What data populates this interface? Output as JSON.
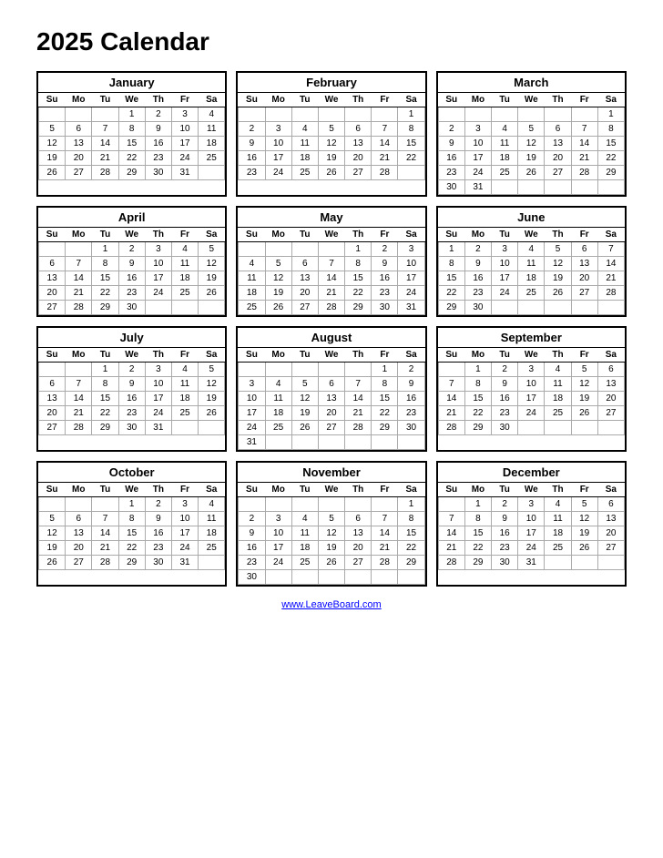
{
  "page": {
    "title": "2025 Calendar",
    "footer_link": "www.LeaveBoard.com"
  },
  "months": [
    {
      "name": "January",
      "days_header": [
        "Su",
        "Mo",
        "Tu",
        "We",
        "Th",
        "Fr",
        "Sa"
      ],
      "weeks": [
        [
          "",
          "",
          "",
          "1",
          "2",
          "3",
          "4"
        ],
        [
          "5",
          "6",
          "7",
          "8",
          "9",
          "10",
          "11"
        ],
        [
          "12",
          "13",
          "14",
          "15",
          "16",
          "17",
          "18"
        ],
        [
          "19",
          "20",
          "21",
          "22",
          "23",
          "24",
          "25"
        ],
        [
          "26",
          "27",
          "28",
          "29",
          "30",
          "31",
          ""
        ]
      ]
    },
    {
      "name": "February",
      "days_header": [
        "Su",
        "Mo",
        "Tu",
        "We",
        "Th",
        "Fr",
        "Sa"
      ],
      "weeks": [
        [
          "",
          "",
          "",
          "",
          "",
          "",
          "1"
        ],
        [
          "2",
          "3",
          "4",
          "5",
          "6",
          "7",
          "8"
        ],
        [
          "9",
          "10",
          "11",
          "12",
          "13",
          "14",
          "15"
        ],
        [
          "16",
          "17",
          "18",
          "19",
          "20",
          "21",
          "22"
        ],
        [
          "23",
          "24",
          "25",
          "26",
          "27",
          "28",
          ""
        ]
      ]
    },
    {
      "name": "March",
      "days_header": [
        "Su",
        "Mo",
        "Tu",
        "We",
        "Th",
        "Fr",
        "Sa"
      ],
      "weeks": [
        [
          "",
          "",
          "",
          "",
          "",
          "",
          "1"
        ],
        [
          "2",
          "3",
          "4",
          "5",
          "6",
          "7",
          "8"
        ],
        [
          "9",
          "10",
          "11",
          "12",
          "13",
          "14",
          "15"
        ],
        [
          "16",
          "17",
          "18",
          "19",
          "20",
          "21",
          "22"
        ],
        [
          "23",
          "24",
          "25",
          "26",
          "27",
          "28",
          "29"
        ],
        [
          "30",
          "31",
          "",
          "",
          "",
          "",
          ""
        ]
      ]
    },
    {
      "name": "April",
      "days_header": [
        "Su",
        "Mo",
        "Tu",
        "We",
        "Th",
        "Fr",
        "Sa"
      ],
      "weeks": [
        [
          "",
          "",
          "1",
          "2",
          "3",
          "4",
          "5"
        ],
        [
          "6",
          "7",
          "8",
          "9",
          "10",
          "11",
          "12"
        ],
        [
          "13",
          "14",
          "15",
          "16",
          "17",
          "18",
          "19"
        ],
        [
          "20",
          "21",
          "22",
          "23",
          "24",
          "25",
          "26"
        ],
        [
          "27",
          "28",
          "29",
          "30",
          "",
          "",
          ""
        ]
      ]
    },
    {
      "name": "May",
      "days_header": [
        "Su",
        "Mo",
        "Tu",
        "We",
        "Th",
        "Fr",
        "Sa"
      ],
      "weeks": [
        [
          "",
          "",
          "",
          "",
          "1",
          "2",
          "3"
        ],
        [
          "4",
          "5",
          "6",
          "7",
          "8",
          "9",
          "10"
        ],
        [
          "11",
          "12",
          "13",
          "14",
          "15",
          "16",
          "17"
        ],
        [
          "18",
          "19",
          "20",
          "21",
          "22",
          "23",
          "24"
        ],
        [
          "25",
          "26",
          "27",
          "28",
          "29",
          "30",
          "31"
        ]
      ]
    },
    {
      "name": "June",
      "days_header": [
        "Su",
        "Mo",
        "Tu",
        "We",
        "Th",
        "Fr",
        "Sa"
      ],
      "weeks": [
        [
          "1",
          "2",
          "3",
          "4",
          "5",
          "6",
          "7"
        ],
        [
          "8",
          "9",
          "10",
          "11",
          "12",
          "13",
          "14"
        ],
        [
          "15",
          "16",
          "17",
          "18",
          "19",
          "20",
          "21"
        ],
        [
          "22",
          "23",
          "24",
          "25",
          "26",
          "27",
          "28"
        ],
        [
          "29",
          "30",
          "",
          "",
          "",
          "",
          ""
        ]
      ]
    },
    {
      "name": "July",
      "days_header": [
        "Su",
        "Mo",
        "Tu",
        "We",
        "Th",
        "Fr",
        "Sa"
      ],
      "weeks": [
        [
          "",
          "",
          "1",
          "2",
          "3",
          "4",
          "5"
        ],
        [
          "6",
          "7",
          "8",
          "9",
          "10",
          "11",
          "12"
        ],
        [
          "13",
          "14",
          "15",
          "16",
          "17",
          "18",
          "19"
        ],
        [
          "20",
          "21",
          "22",
          "23",
          "24",
          "25",
          "26"
        ],
        [
          "27",
          "28",
          "29",
          "30",
          "31",
          "",
          ""
        ]
      ]
    },
    {
      "name": "August",
      "days_header": [
        "Su",
        "Mo",
        "Tu",
        "We",
        "Th",
        "Fr",
        "Sa"
      ],
      "weeks": [
        [
          "",
          "",
          "",
          "",
          "",
          "1",
          "2"
        ],
        [
          "3",
          "4",
          "5",
          "6",
          "7",
          "8",
          "9"
        ],
        [
          "10",
          "11",
          "12",
          "13",
          "14",
          "15",
          "16"
        ],
        [
          "17",
          "18",
          "19",
          "20",
          "21",
          "22",
          "23"
        ],
        [
          "24",
          "25",
          "26",
          "27",
          "28",
          "29",
          "30"
        ],
        [
          "31",
          "",
          "",
          "",
          "",
          "",
          ""
        ]
      ]
    },
    {
      "name": "September",
      "days_header": [
        "Su",
        "Mo",
        "Tu",
        "We",
        "Th",
        "Fr",
        "Sa"
      ],
      "weeks": [
        [
          "",
          "1",
          "2",
          "3",
          "4",
          "5",
          "6"
        ],
        [
          "7",
          "8",
          "9",
          "10",
          "11",
          "12",
          "13"
        ],
        [
          "14",
          "15",
          "16",
          "17",
          "18",
          "19",
          "20"
        ],
        [
          "21",
          "22",
          "23",
          "24",
          "25",
          "26",
          "27"
        ],
        [
          "28",
          "29",
          "30",
          "",
          "",
          "",
          ""
        ]
      ]
    },
    {
      "name": "October",
      "days_header": [
        "Su",
        "Mo",
        "Tu",
        "We",
        "Th",
        "Fr",
        "Sa"
      ],
      "weeks": [
        [
          "",
          "",
          "",
          "1",
          "2",
          "3",
          "4"
        ],
        [
          "5",
          "6",
          "7",
          "8",
          "9",
          "10",
          "11"
        ],
        [
          "12",
          "13",
          "14",
          "15",
          "16",
          "17",
          "18"
        ],
        [
          "19",
          "20",
          "21",
          "22",
          "23",
          "24",
          "25"
        ],
        [
          "26",
          "27",
          "28",
          "29",
          "30",
          "31",
          ""
        ]
      ]
    },
    {
      "name": "November",
      "days_header": [
        "Su",
        "Mo",
        "Tu",
        "We",
        "Th",
        "Fr",
        "Sa"
      ],
      "weeks": [
        [
          "",
          "",
          "",
          "",
          "",
          "",
          "1"
        ],
        [
          "2",
          "3",
          "4",
          "5",
          "6",
          "7",
          "8"
        ],
        [
          "9",
          "10",
          "11",
          "12",
          "13",
          "14",
          "15"
        ],
        [
          "16",
          "17",
          "18",
          "19",
          "20",
          "21",
          "22"
        ],
        [
          "23",
          "24",
          "25",
          "26",
          "27",
          "28",
          "29"
        ],
        [
          "30",
          "",
          "",
          "",
          "",
          "",
          ""
        ]
      ]
    },
    {
      "name": "December",
      "days_header": [
        "Su",
        "Mo",
        "Tu",
        "We",
        "Th",
        "Fr",
        "Sa"
      ],
      "weeks": [
        [
          "",
          "1",
          "2",
          "3",
          "4",
          "5",
          "6"
        ],
        [
          "7",
          "8",
          "9",
          "10",
          "11",
          "12",
          "13"
        ],
        [
          "14",
          "15",
          "16",
          "17",
          "18",
          "19",
          "20"
        ],
        [
          "21",
          "22",
          "23",
          "24",
          "25",
          "26",
          "27"
        ],
        [
          "28",
          "29",
          "30",
          "31",
          "",
          "",
          ""
        ]
      ]
    }
  ]
}
